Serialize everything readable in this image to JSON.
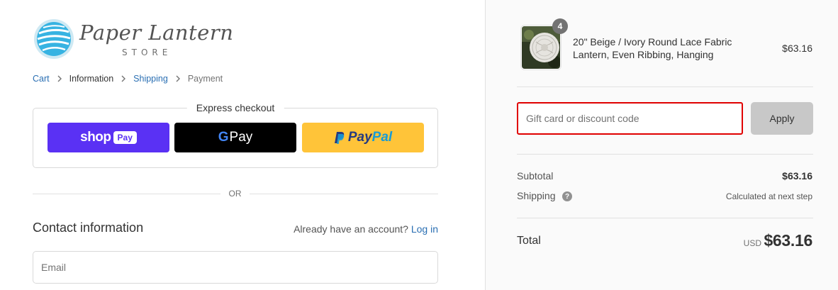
{
  "logo": {
    "script_text": "Paper Lantern",
    "store_text": "STORE"
  },
  "breadcrumb": {
    "items": [
      {
        "label": "Cart",
        "state": "link"
      },
      {
        "label": "Information",
        "state": "current"
      },
      {
        "label": "Shipping",
        "state": "link"
      },
      {
        "label": "Payment",
        "state": "muted"
      }
    ]
  },
  "express_checkout": {
    "title": "Express checkout",
    "shop_pay": {
      "word": "shop",
      "pill": "Pay"
    },
    "google_pay": {
      "g": "G",
      "word": "Pay"
    },
    "paypal": {
      "part1": "Pay",
      "part2": "Pal"
    }
  },
  "divider_text": "OR",
  "contact": {
    "title": "Contact information",
    "account_prompt": "Already have an account?",
    "login_link": "Log in",
    "email_placeholder": "Email"
  },
  "order": {
    "product": {
      "quantity": "4",
      "name": "20\" Beige / Ivory Round Lace Fabric Lantern, Even Ribbing, Hanging",
      "price": "$63.16"
    },
    "discount": {
      "placeholder": "Gift card or discount code",
      "apply_label": "Apply"
    },
    "subtotal_label": "Subtotal",
    "subtotal_value": "$63.16",
    "shipping_label": "Shipping",
    "shipping_help": "?",
    "shipping_value": "Calculated at next step",
    "total_label": "Total",
    "total_currency": "USD",
    "total_value": "$63.16"
  },
  "colors": {
    "link": "#2a6fb3",
    "shop_pay": "#5a31f4",
    "google_pay": "#000000",
    "paypal": "#ffc439",
    "discount_border": "#e00000",
    "apply_button": "#c8c8c8"
  }
}
